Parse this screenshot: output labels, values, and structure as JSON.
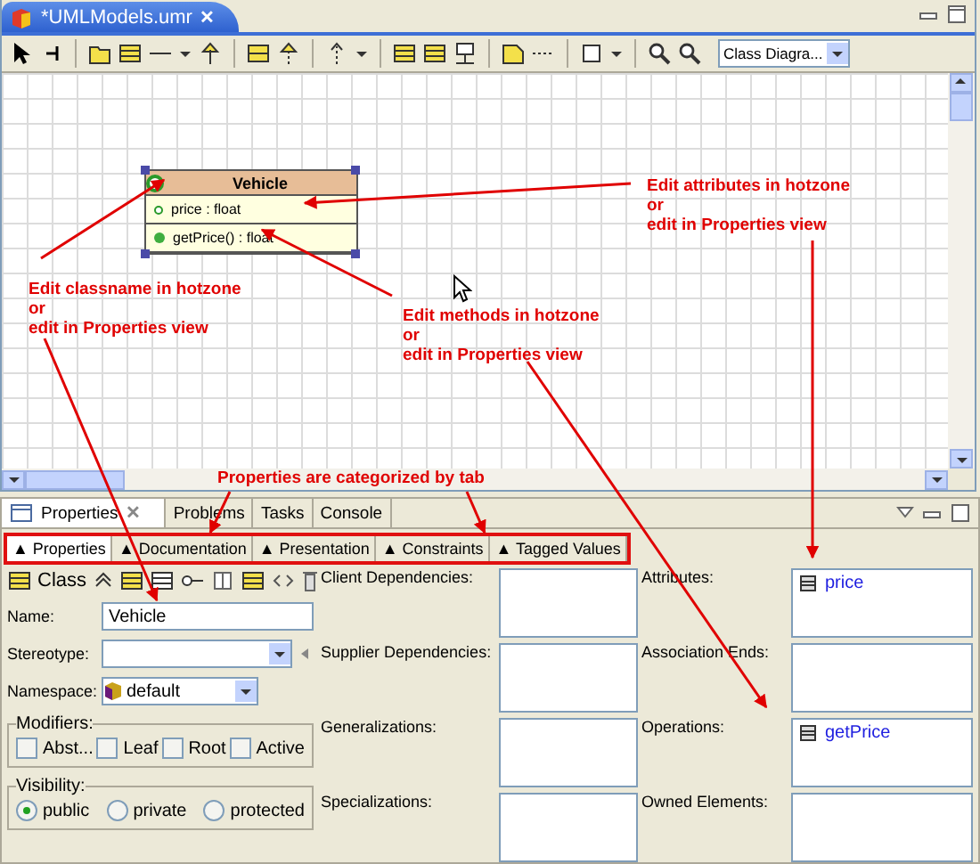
{
  "editor": {
    "tab": {
      "title": "*UMLModels.umr",
      "close": "✕",
      "selected": true
    },
    "diagram_selector": "Class Diagra..."
  },
  "diagram": {
    "class": {
      "name": "Vehicle",
      "attributes": [
        "price : float"
      ],
      "operations": [
        "getPrice() : float"
      ],
      "selected": true
    },
    "annotations": [
      {
        "lines": [
          "Edit attributes in hotzone",
          "or",
          "edit in Properties view"
        ]
      },
      {
        "lines": [
          "Edit classname in hotzone",
          "or",
          "edit in Properties view"
        ]
      },
      {
        "lines": [
          "Edit methods in hotzone",
          "or",
          "edit in Properties view"
        ]
      }
    ],
    "tab_note": "Properties are categorized by tab"
  },
  "views": {
    "tabs": [
      {
        "label": "Properties",
        "close": "✕",
        "selected": true
      },
      {
        "label": "Problems",
        "selected": false
      },
      {
        "label": "Tasks",
        "selected": false
      },
      {
        "label": "Console",
        "selected": false
      }
    ]
  },
  "properties": {
    "tabs": [
      {
        "label": "▲ Properties",
        "selected": true
      },
      {
        "label": "▲ Documentation",
        "selected": false
      },
      {
        "label": "▲ Presentation",
        "selected": false
      },
      {
        "label": "▲ Constraints",
        "selected": false
      },
      {
        "label": "▲ Tagged Values",
        "selected": false
      }
    ],
    "element_type": "Class",
    "name": {
      "label": "Name:",
      "value": "Vehicle"
    },
    "stereotype": {
      "label": "Stereotype:"
    },
    "namespace": {
      "label": "Namespace:",
      "value": "default"
    },
    "modifiers": {
      "title": "Modifiers:",
      "items": [
        {
          "label": "Abst...",
          "checked": false
        },
        {
          "label": "Leaf",
          "checked": false
        },
        {
          "label": "Root",
          "checked": false
        },
        {
          "label": "Active",
          "checked": false
        }
      ]
    },
    "visibility": {
      "title": "Visibility:",
      "options": [
        {
          "label": "public",
          "selected": true
        },
        {
          "label": "private",
          "selected": false
        },
        {
          "label": "protected",
          "selected": false
        }
      ]
    },
    "relation_lists": [
      {
        "label": "Client Dependencies:"
      },
      {
        "label": "Supplier Dependencies:"
      },
      {
        "label": "Generalizations:"
      },
      {
        "label": "Specializations:"
      }
    ],
    "member_lists": [
      {
        "label": "Attributes:",
        "items": [
          "price"
        ]
      },
      {
        "label": "Association Ends:"
      },
      {
        "label": "Operations:",
        "items": [
          "getPrice"
        ]
      },
      {
        "label": "Owned Elements:"
      }
    ]
  }
}
